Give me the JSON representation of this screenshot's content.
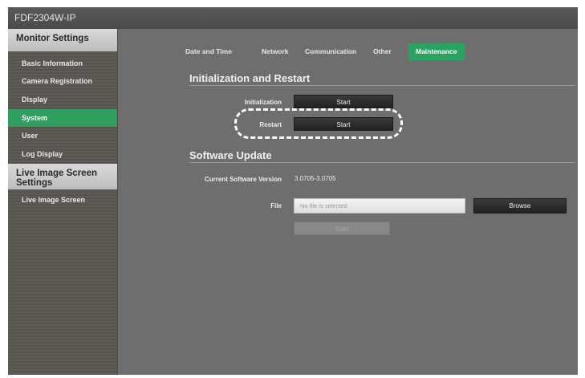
{
  "window": {
    "title": "FDF2304W-IP"
  },
  "sidebar": {
    "sections": [
      {
        "title": "Monitor Settings",
        "items": [
          {
            "label": "Basic Information",
            "active": false
          },
          {
            "label": "Camera Registration",
            "active": false
          },
          {
            "label": "Display",
            "active": false
          },
          {
            "label": "System",
            "active": true
          },
          {
            "label": "User",
            "active": false
          },
          {
            "label": "Log Display",
            "active": false
          }
        ]
      },
      {
        "title": "Live Image Screen Settings",
        "items": [
          {
            "label": "Live Image Screen",
            "active": false
          }
        ]
      }
    ]
  },
  "tabs": [
    {
      "label": "Date and Time",
      "active": false
    },
    {
      "label": "Network",
      "active": false
    },
    {
      "label": "Communication",
      "active": false
    },
    {
      "label": "Other",
      "active": false
    },
    {
      "label": "Maintenance",
      "active": true
    }
  ],
  "init_restart": {
    "title": "Initialization and Restart",
    "initialization_label": "Initialization",
    "initialization_button": "Start",
    "restart_label": "Restart",
    "restart_button": "Start"
  },
  "software_update": {
    "title": "Software Update",
    "current_version_label": "Current Software Version",
    "current_version_value": "3.0705-3.0705",
    "file_label": "File",
    "file_placeholder": "No file is selected",
    "browse_button": "Browse",
    "start_button": "Start"
  },
  "colors": {
    "accent_green": "#2aa262",
    "content_bg": "#6e6e6e",
    "titlebar_bg": "#4a4a4a"
  }
}
